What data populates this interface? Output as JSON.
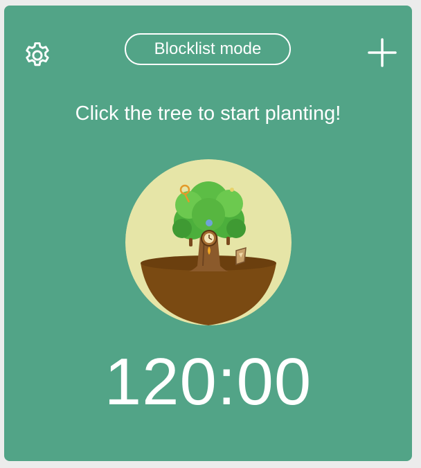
{
  "header": {
    "mode_label": "Blocklist mode",
    "settings_icon": "gear-icon",
    "add_icon": "plus-icon"
  },
  "hint": "Click the tree to start planting!",
  "tree": {
    "icon": "tree-illustration"
  },
  "timer": "120:00",
  "colors": {
    "panel": "#52a487",
    "circle": "#e6e5a7",
    "soil": "#7a4a12",
    "text": "#ffffff"
  }
}
